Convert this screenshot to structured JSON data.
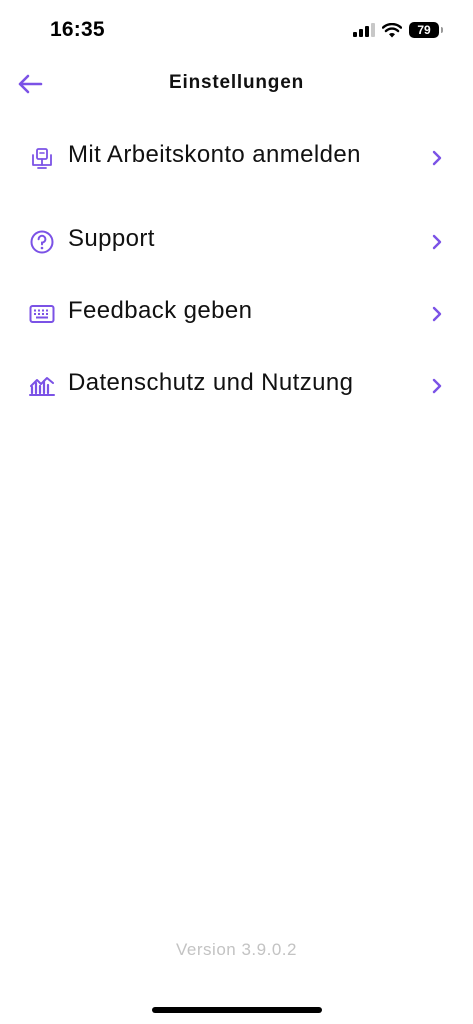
{
  "status_bar": {
    "time": "16:35",
    "battery_level": "79",
    "icons": [
      "cellular-signal-icon",
      "wifi-icon",
      "battery-icon"
    ]
  },
  "nav": {
    "title": "Einstellungen",
    "back_icon": "arrow-left-icon"
  },
  "menu": {
    "items": [
      {
        "label": "Mit Arbeitskonto anmelden",
        "icon": "work-account-icon"
      },
      {
        "label": "Support",
        "icon": "question-circle-icon"
      },
      {
        "label": "Feedback geben",
        "icon": "keyboard-icon"
      },
      {
        "label": "Datenschutz und Nutzung",
        "icon": "analytics-chart-icon"
      }
    ],
    "chevron_icon": "chevron-right-icon"
  },
  "footer": {
    "version": "Version 3.9.0.2"
  },
  "colors": {
    "accent": "#7b52e6",
    "text": "#111111",
    "muted": "#c3c3c3",
    "background": "#ffffff"
  }
}
